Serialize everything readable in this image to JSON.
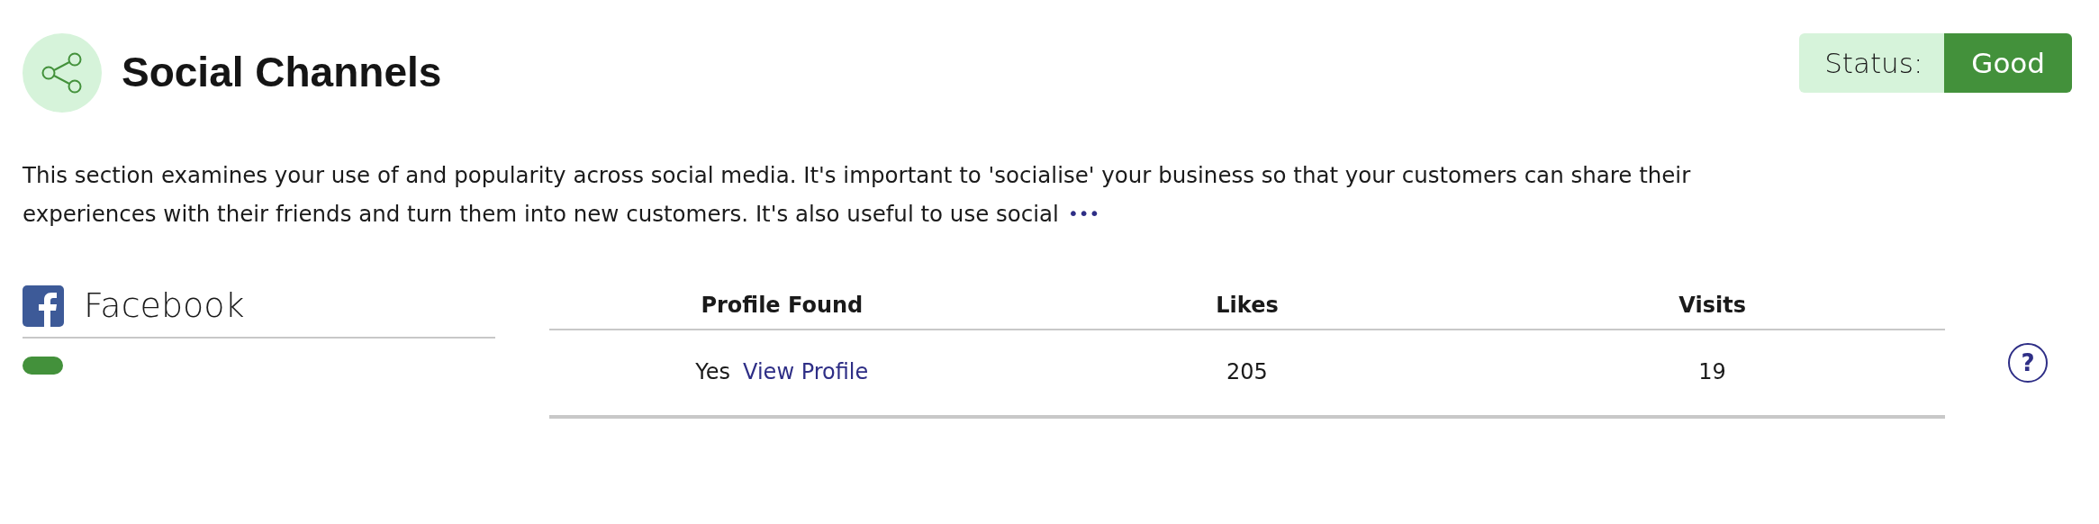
{
  "header": {
    "title": "Social Channels",
    "status": {
      "label": "Status:",
      "value": "Good"
    }
  },
  "description": {
    "lines": [
      "This section examines your use of and popularity across social media. It's important to 'socialise' your business so that your customers can share their",
      "experiences with their friends and turn them into new customers. It's also useful to use social"
    ],
    "more": "•••"
  },
  "channel": {
    "name": "Facebook"
  },
  "table": {
    "columns": [
      "Profile Found",
      "Likes",
      "Visits"
    ],
    "rows": [
      {
        "found": "Yes",
        "link": "View Profile",
        "likes": "205",
        "visits": "19"
      }
    ]
  },
  "help": "?"
}
